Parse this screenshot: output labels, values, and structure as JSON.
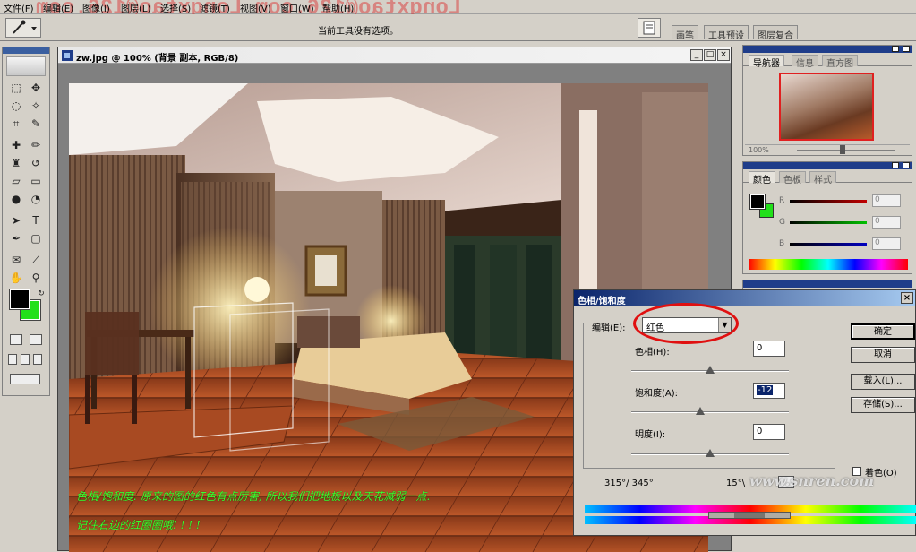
{
  "menu": {
    "items": [
      "文件(F)",
      "编辑(E)",
      "图像(I)",
      "图层(L)",
      "选择(S)",
      "滤镜(T)",
      "视图(V)",
      "窗口(W)",
      "帮助(H)"
    ],
    "watermark": "Longxtao@126.com  Longxtao@126.com"
  },
  "options_bar": {
    "status_text": "当前工具没有选项。",
    "palette_well_tabs": [
      "画笔",
      "工具预设",
      "图层复合"
    ]
  },
  "toolbox": {
    "foreground_color": "#000000",
    "background_color": "#22e01a"
  },
  "document": {
    "title": "zw.jpg @ 100% (背景 副本, RGB/8)",
    "caption_line1": "色相/饱和度: 原来的图的红色有点厉害, 所以我们把地板以及天花减弱一点.",
    "caption_line2": "记住右边的红圈圈哦! ! ! !"
  },
  "navigator_panel": {
    "tabs": [
      "导航器",
      "信息",
      "直方图"
    ],
    "zoom": "100%"
  },
  "color_panel": {
    "tabs": [
      "颜色",
      "色板",
      "样式"
    ],
    "channels": [
      {
        "label": "R",
        "value": "0",
        "color": "#c00000"
      },
      {
        "label": "G",
        "value": "0",
        "color": "#00a000"
      },
      {
        "label": "B",
        "value": "0",
        "color": "#0000b0"
      }
    ]
  },
  "hue_saturation_dialog": {
    "title": "色相/饱和度",
    "edit_label": "编辑(E):",
    "edit_value": "红色",
    "hue_label": "色相(H):",
    "hue_value": "0",
    "saturation_label": "饱和度(A):",
    "saturation_value": "-12",
    "lightness_label": "明度(I):",
    "lightness_value": "0",
    "buttons": {
      "ok": "确定",
      "cancel": "取消",
      "load": "载入(L)...",
      "save": "存储(S)..."
    },
    "colorize_label": "着色(O)",
    "range_left": "315°/ 345°",
    "range_right": "15°\\"
  },
  "site_watermark": "www.snren.com"
}
